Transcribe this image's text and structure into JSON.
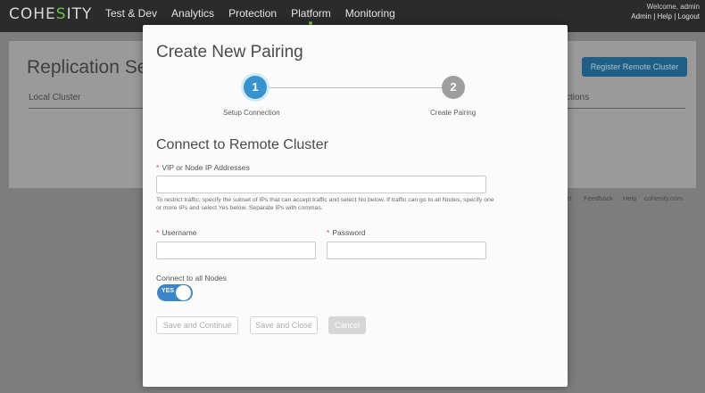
{
  "nav": {
    "logo_prefix": "COHE",
    "logo_accent": "S",
    "logo_suffix": "ITY",
    "items": [
      "Test & Dev",
      "Analytics",
      "Protection",
      "Platform",
      "Monitoring"
    ],
    "active_item": "Platform",
    "welcome": "Welcome, admin",
    "user_links": [
      "Admin",
      "Help",
      "Logout"
    ],
    "link_separator": "|"
  },
  "background": {
    "title": "Replication Set",
    "columns": {
      "local": "Local Cluster",
      "actions": "ctions"
    },
    "register_button": "Register Remote Cluster",
    "footer": [
      "rt",
      "Feedback",
      "Help",
      "cohesity.com"
    ]
  },
  "modal": {
    "title": "Create New Pairing",
    "steps": [
      {
        "number": "1",
        "label": "Setup Connection",
        "state": "active"
      },
      {
        "number": "2",
        "label": "Create Pairing",
        "state": "pending"
      }
    ],
    "section_title": "Connect to Remote Cluster",
    "required_marker": "*",
    "vip_label": "VIP or Node IP Addresses",
    "vip_value": "",
    "vip_help": "To restrict traffic, specify the subset of IPs that can accept traffic and select No below. If traffic can go to all Nodes, specify one or more IPs and select Yes below. Separate IPs with commas.",
    "username_label": "Username",
    "username_value": "",
    "password_label": "Password",
    "password_value": "",
    "connect_all_label": "Connect to all Nodes",
    "connect_all_state": "YES",
    "buttons": {
      "save_continue": "Save and Continue",
      "save_close": "Save and Close",
      "cancel": "Cancel"
    }
  },
  "colors": {
    "accent_blue": "#3793d0",
    "toggle_blue": "#3a86c8",
    "brand_green": "#6cc04a",
    "required_red": "#d9534f"
  }
}
